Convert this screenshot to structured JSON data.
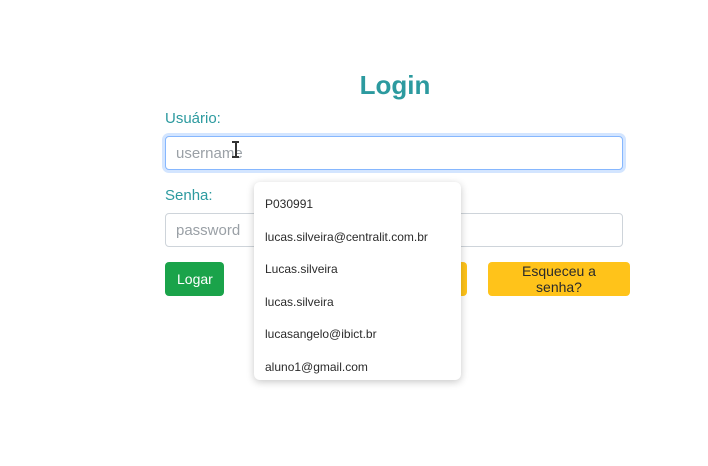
{
  "form": {
    "title": "Login",
    "username_label": "Usuário:",
    "username_placeholder": "username",
    "password_label": "Senha:",
    "password_placeholder": "password",
    "login_button": "Logar",
    "forgot_button": "Esqueceu a senha?"
  },
  "autocomplete": {
    "items": [
      "P030991",
      "lucas.silveira@centralit.com.br",
      "Lucas.silveira",
      "lucas.silveira",
      "lucasangelo@ibict.br",
      "aluno1@gmail.com"
    ]
  },
  "colors": {
    "accent": "#2c9a9f",
    "login_button": "#1aa34a",
    "forgot_button": "#ffc31a",
    "focus_border": "#86b7fe"
  }
}
